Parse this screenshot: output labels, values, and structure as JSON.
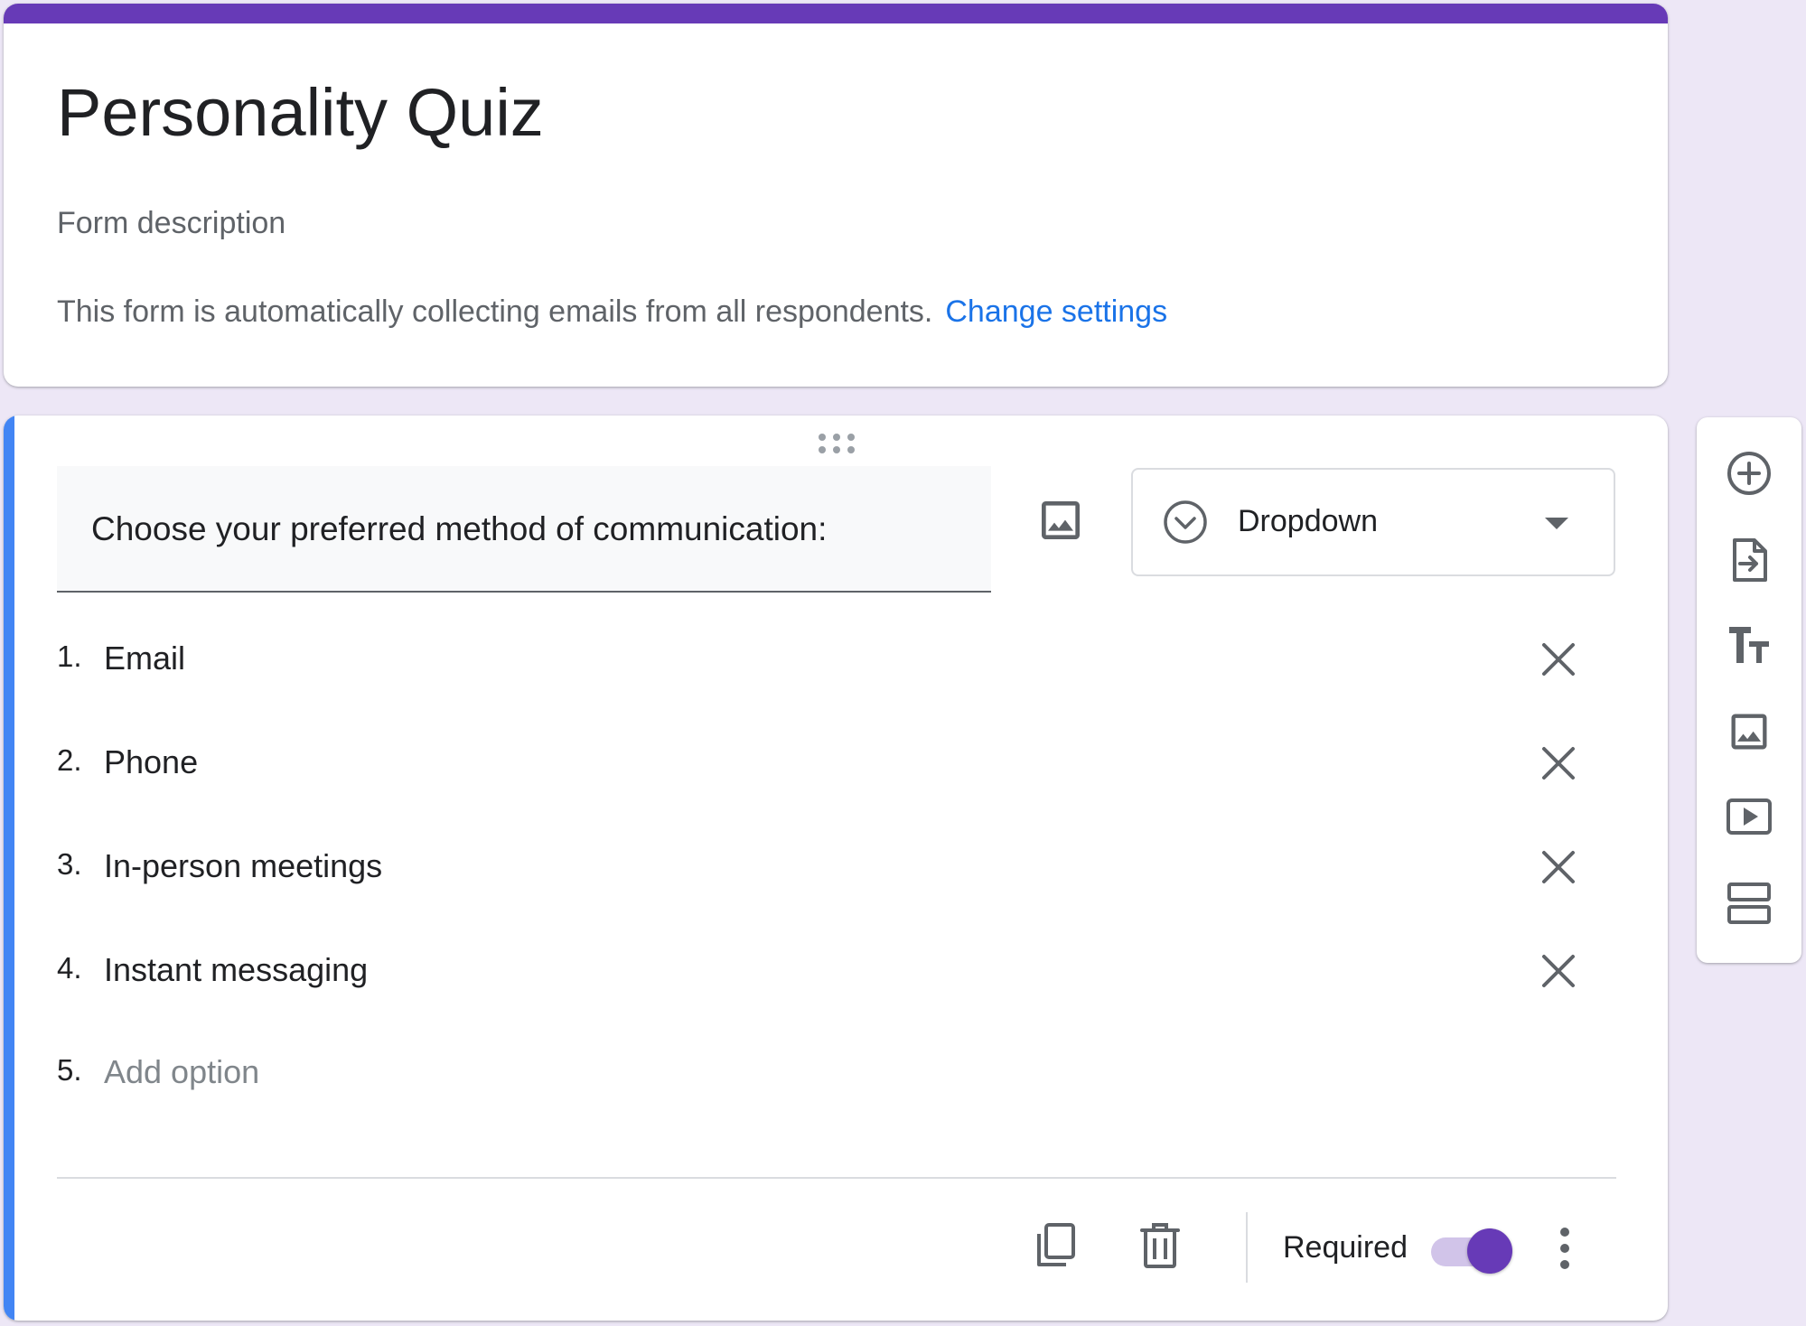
{
  "form": {
    "title": "Personality Quiz",
    "description_placeholder": "Form description",
    "email_notice": "This form is automatically collecting emails from all respondents.",
    "change_settings_label": "Change settings"
  },
  "question": {
    "text": "Choose your preferred method of communication:",
    "type_label": "Dropdown",
    "options": [
      {
        "number": "1.",
        "label": "Email"
      },
      {
        "number": "2.",
        "label": "Phone"
      },
      {
        "number": "3.",
        "label": "In-person meetings"
      },
      {
        "number": "4.",
        "label": "Instant messaging"
      }
    ],
    "add_option": {
      "number": "5.",
      "label": "Add option"
    },
    "required_label": "Required",
    "required": true
  },
  "toolbar": {
    "icons": [
      "add-question-icon",
      "import-questions-icon",
      "add-title-icon",
      "add-image-icon",
      "add-video-icon",
      "add-section-icon"
    ]
  },
  "colors": {
    "theme": "#673ab7",
    "background": "#ede7f6",
    "focus": "#4285f4",
    "link": "#1a73e8"
  }
}
